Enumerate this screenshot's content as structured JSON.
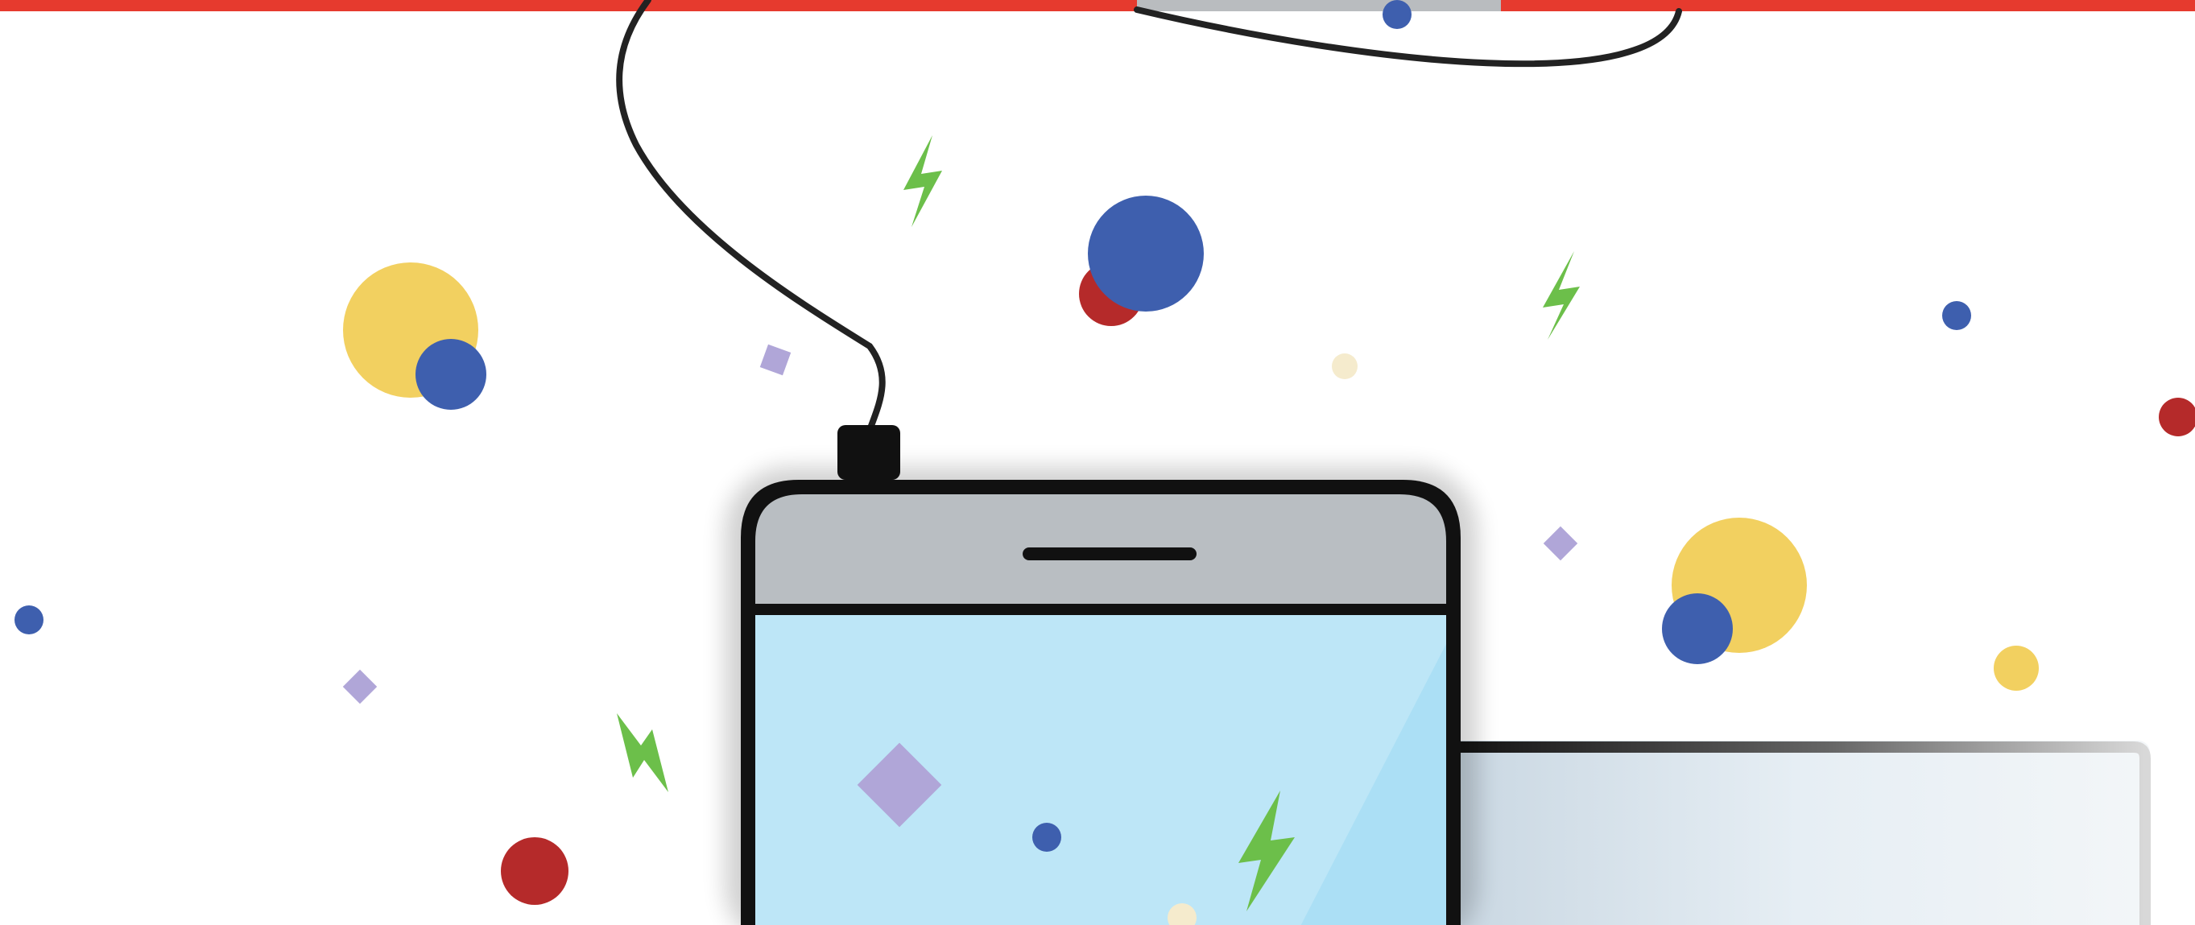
{
  "illustration": {
    "subject": "smartphone-charging-via-cable",
    "background_color": "#ffffff",
    "colors": {
      "top_bar_red": "#e63a2e",
      "top_bar_gray": "#b9bcbf",
      "phone_outline": "#111111",
      "phone_top_panel": "#b9bec2",
      "phone_screen": "#bde6f7",
      "screen_glare": "#a8def4",
      "cable": "#222222",
      "dot_blue": "#3e5fae",
      "dot_yellow": "#f2d060",
      "dot_red": "#b52a2a",
      "dot_cream": "#f5ebcd",
      "diamond_lavender": "#b0a6d8",
      "bolt_green": "#6cbf4a",
      "laptop_screen": "#e6eef4",
      "laptop_frame": "#cfd4d8"
    },
    "icons": [
      "lightning-bolt-icon",
      "phone-icon",
      "charging-cable-icon",
      "laptop-icon"
    ]
  }
}
